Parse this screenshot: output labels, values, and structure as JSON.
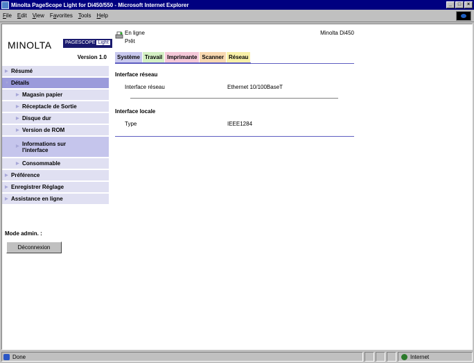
{
  "window": {
    "title": "Minolta PageScope Light for Di450/550 - Microsoft Internet Explorer",
    "minimize": "_",
    "maximize": "□",
    "close": "×"
  },
  "menu": {
    "items": [
      {
        "key": "F",
        "rest": "ile"
      },
      {
        "key": "E",
        "rest": "dit"
      },
      {
        "key": "V",
        "rest": "iew"
      },
      {
        "key": "a",
        "pre": "F",
        "rest": "vorites"
      },
      {
        "key": "T",
        "rest": "ools"
      },
      {
        "key": "H",
        "rest": "elp"
      }
    ]
  },
  "branding": {
    "logo": "MINOLTA",
    "product": "PAGESCOPE",
    "product_suffix": "Light",
    "version": "Version 1.0"
  },
  "status": {
    "online": "En ligne",
    "ready": "Prêt",
    "model": "Minolta Di450"
  },
  "tabs": [
    {
      "label": "Système"
    },
    {
      "label": "Travail"
    },
    {
      "label": "Imprimante"
    },
    {
      "label": "Scanner"
    },
    {
      "label": "Réseau"
    }
  ],
  "sidebar": {
    "items": [
      {
        "label": "Résumé"
      },
      {
        "label": "Détails"
      },
      {
        "label": "Magasin papier"
      },
      {
        "label": "Réceptacle de Sortie"
      },
      {
        "label": "Disque dur"
      },
      {
        "label": "Version de ROM"
      },
      {
        "label": "Informations sur l'interface"
      },
      {
        "label": "Consommable"
      },
      {
        "label": "Préférence"
      },
      {
        "label": "Enregistrer Réglage"
      },
      {
        "label": "Assistance en ligne"
      }
    ],
    "admin_label": "Mode admin. :",
    "logout_button": "Déconnexion"
  },
  "content": {
    "network": {
      "heading": "Interface réseau",
      "label": "Interface réseau",
      "value": "Ethernet 10/100BaseT"
    },
    "local": {
      "heading": "Interface locale",
      "label": "Type",
      "value": "IEEE1284"
    }
  },
  "statusbar": {
    "text": "Done",
    "zone": "Internet"
  }
}
